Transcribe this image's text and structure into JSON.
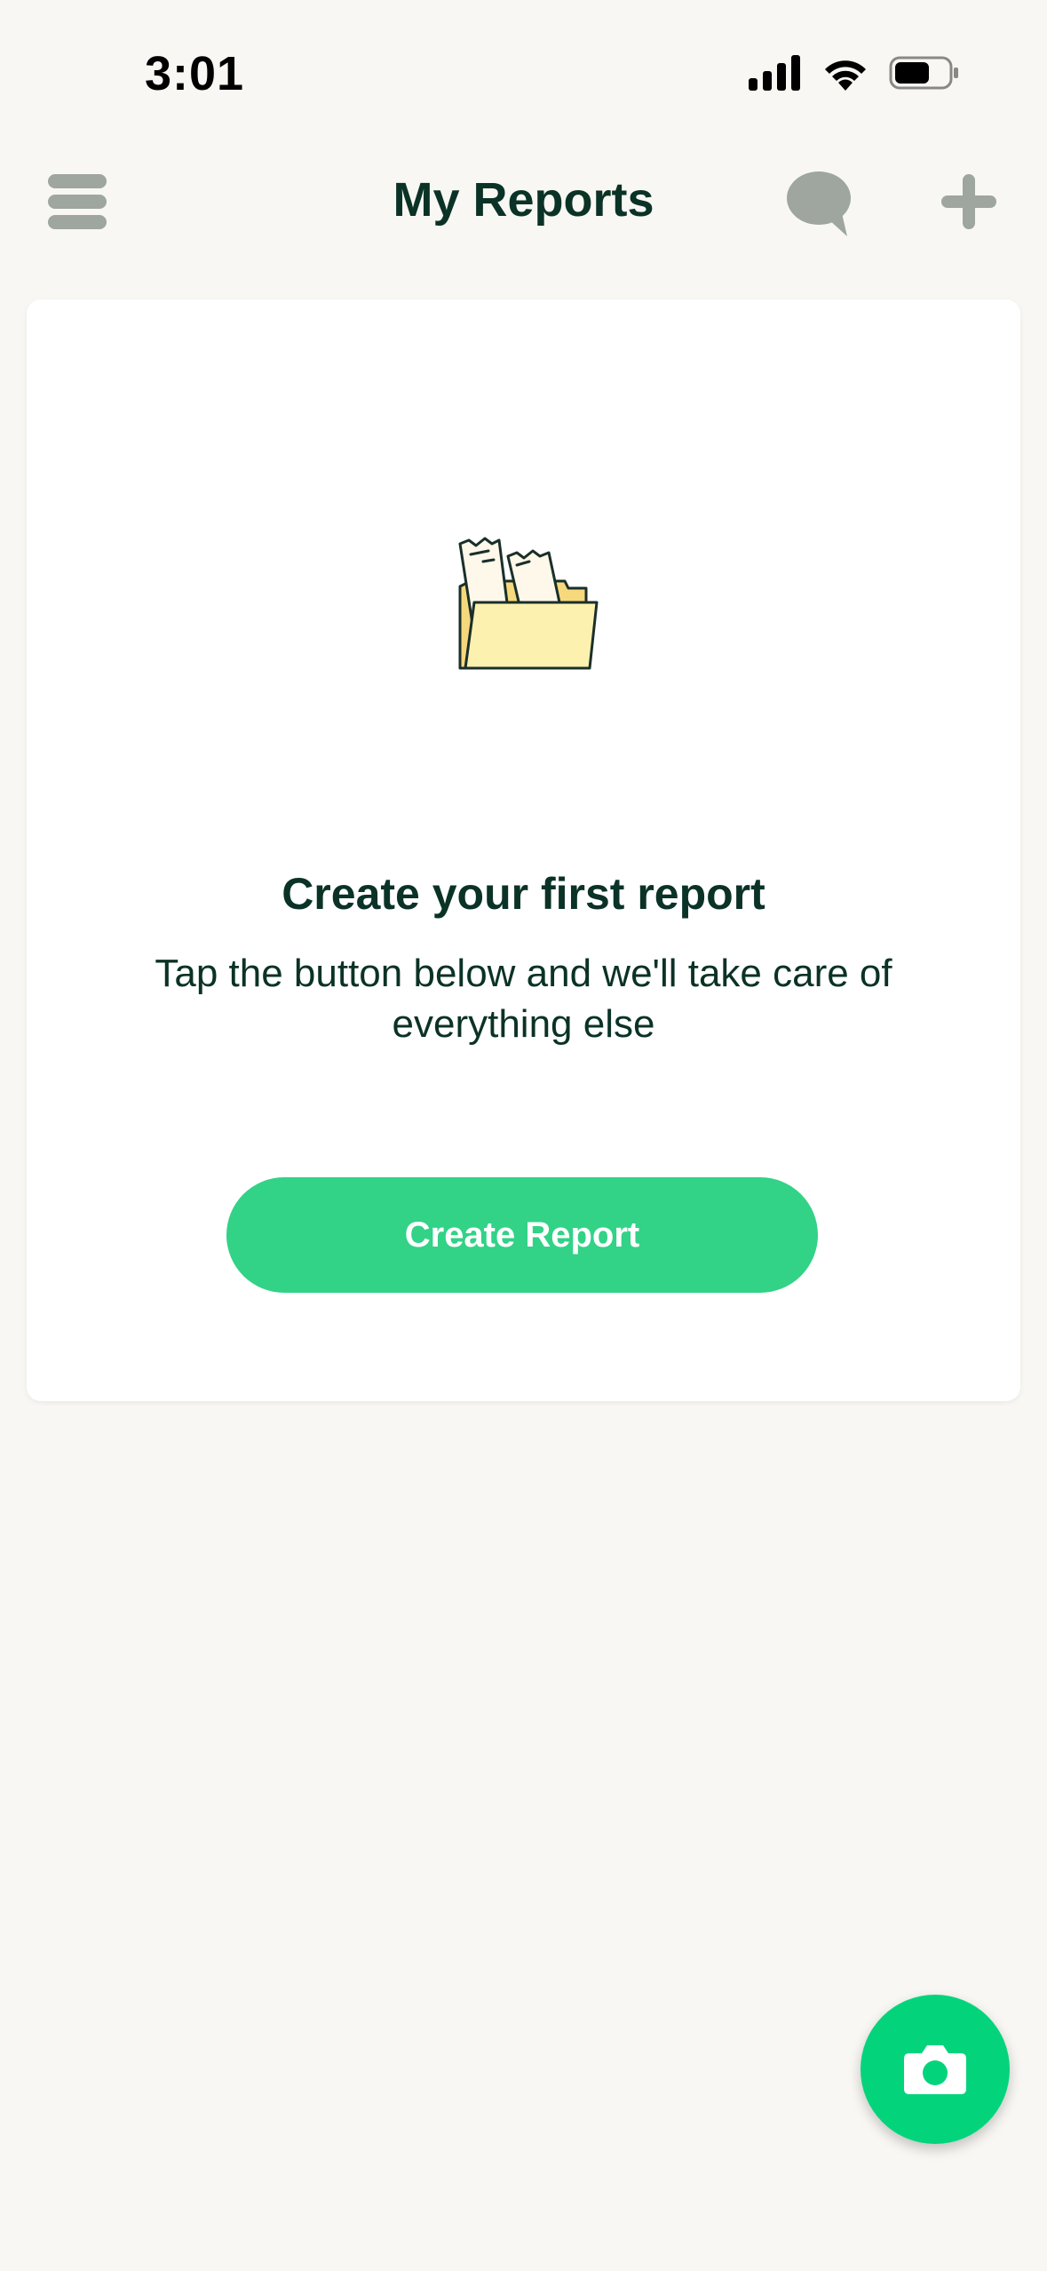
{
  "status_bar": {
    "time": "3:01",
    "icons": [
      "cellular-signal-icon",
      "wifi-icon",
      "battery-icon"
    ]
  },
  "header": {
    "title": "My Reports",
    "menu_icon": "hamburger-menu-icon",
    "chat_icon": "chat-bubble-icon",
    "add_icon": "plus-icon"
  },
  "empty_state": {
    "illustration": "folder-with-receipts-illustration",
    "heading": "Create your first report",
    "description": "Tap the button below and we'll take care of everything else",
    "button_label": "Create Report"
  },
  "fab": {
    "icon": "camera-icon"
  },
  "colors": {
    "background": "#f8f7f3",
    "card": "#ffffff",
    "accent_green": "#32d287",
    "fab_green": "#03d47c",
    "text_dark": "#0b3226",
    "icon_gray": "#9ea69f"
  }
}
